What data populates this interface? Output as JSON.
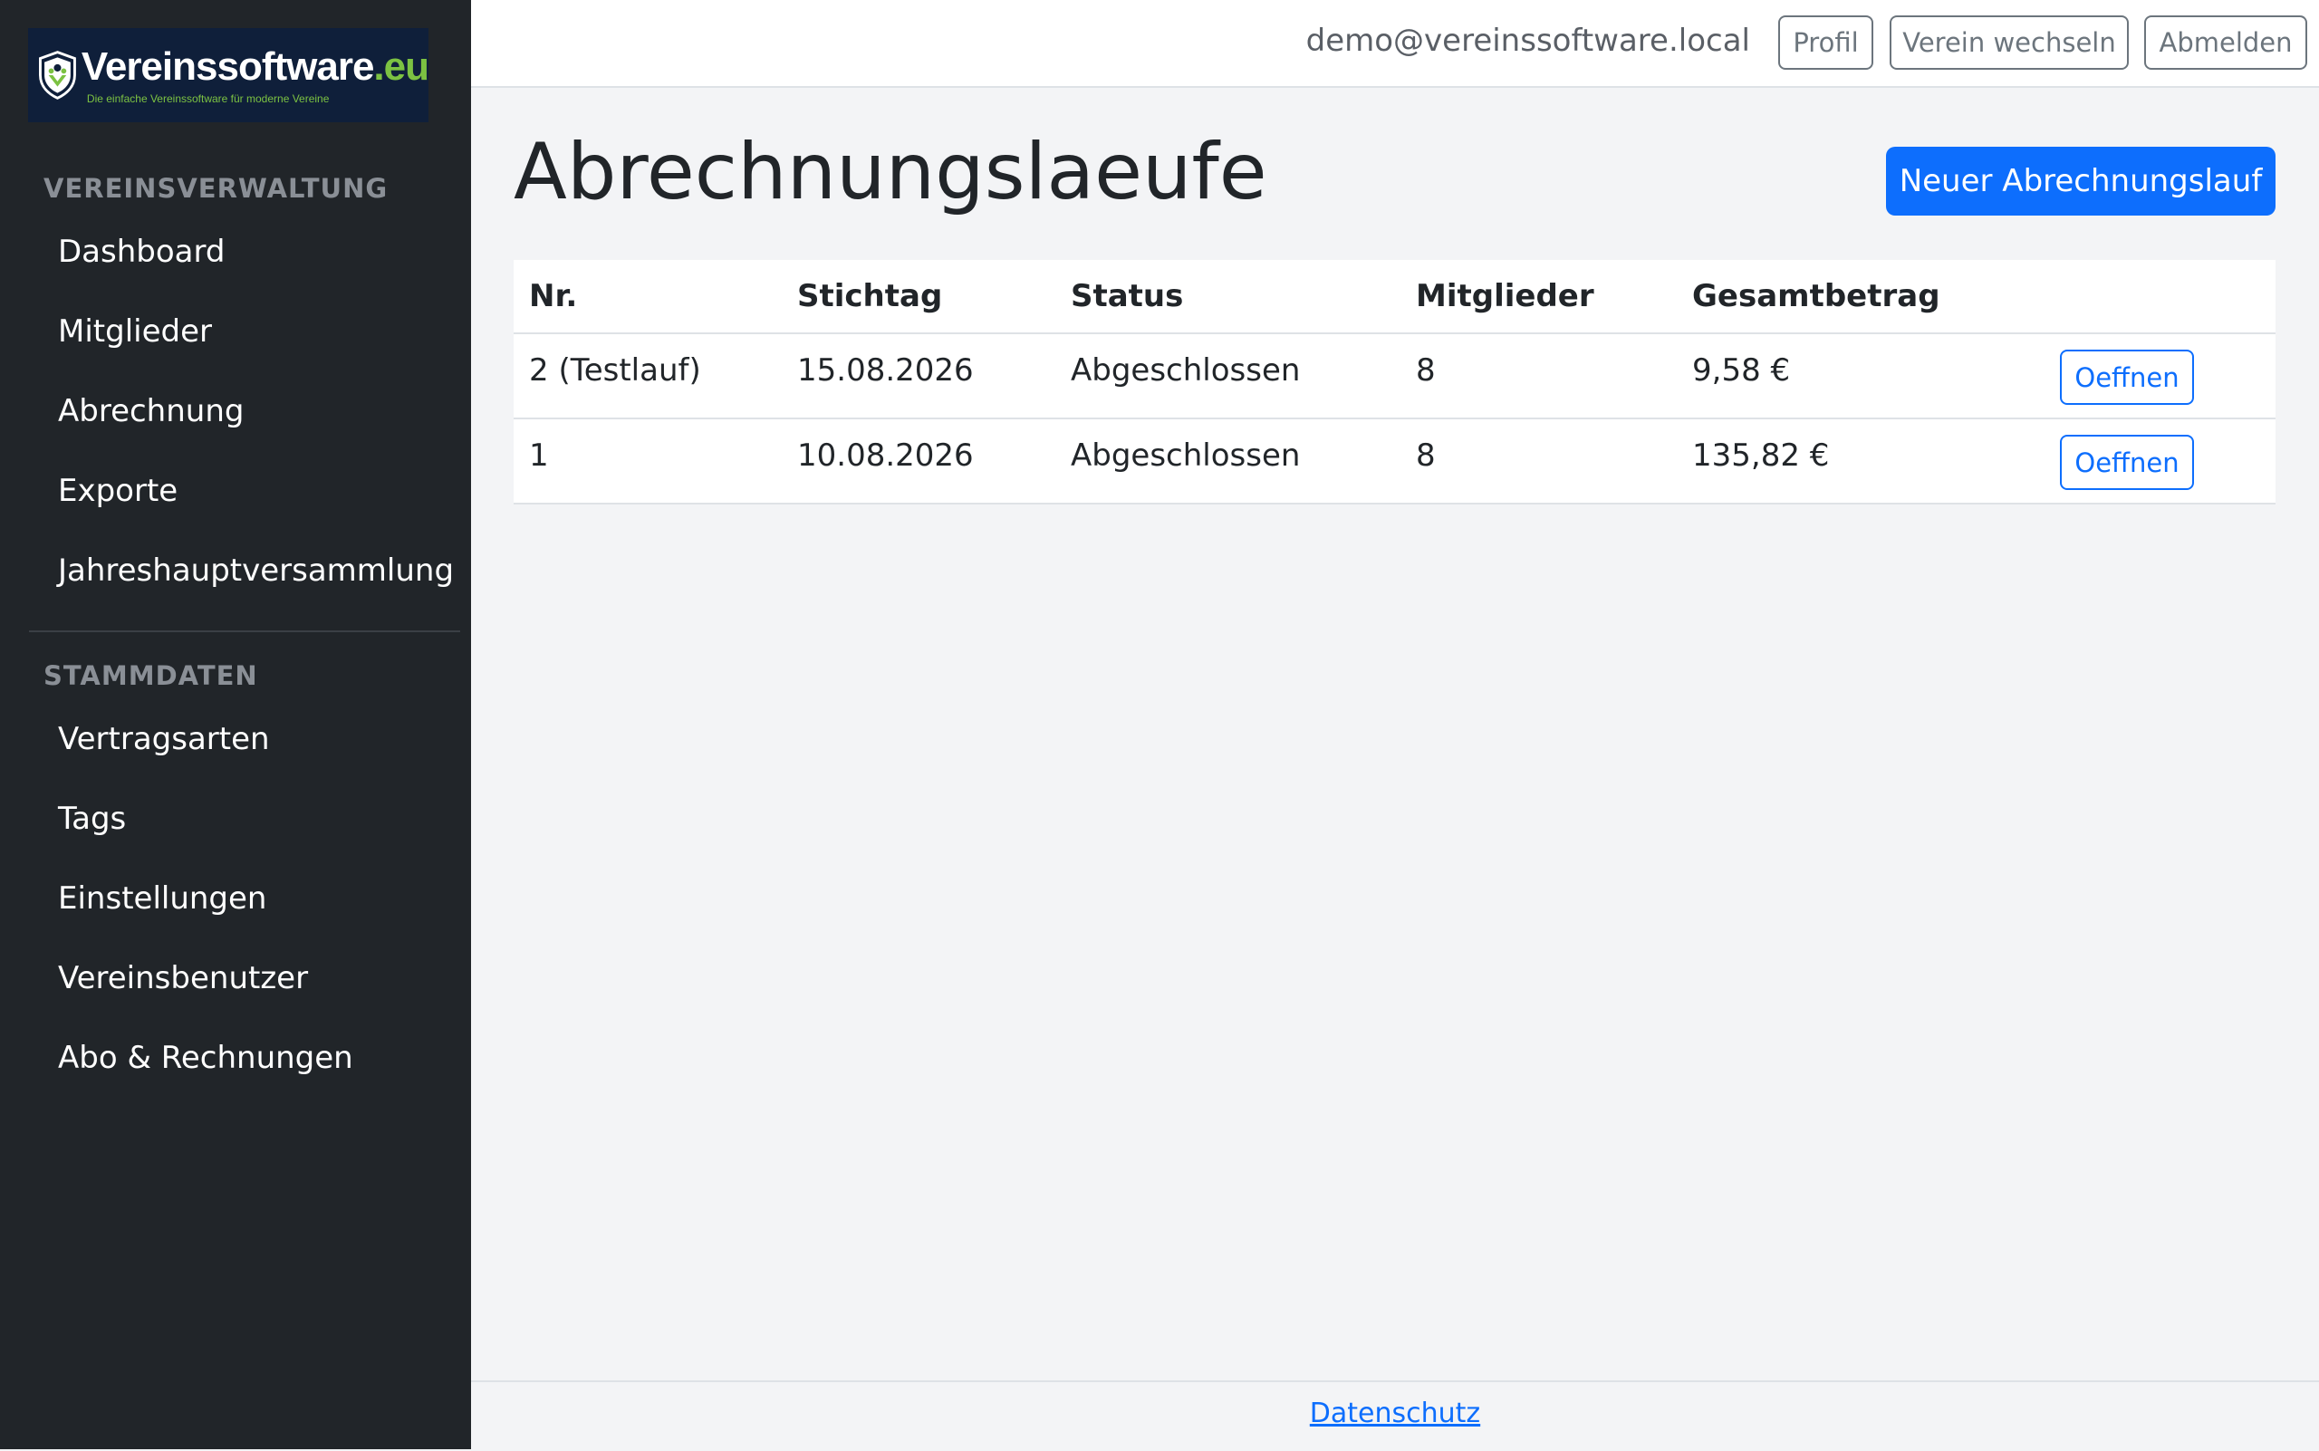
{
  "brand": {
    "name": "Vereinssoftware",
    "tld": ".eu",
    "tagline": "Die einfache Vereinssoftware für moderne Vereine",
    "colors": {
      "navy": "#0f1f3a",
      "green": "#7cc242"
    }
  },
  "sidebar": {
    "section1": "VEREINSVERWALTUNG",
    "items1": [
      "Dashboard",
      "Mitglieder",
      "Abrechnung",
      "Exporte",
      "Jahreshauptversammlung"
    ],
    "section2": "STAMMDATEN",
    "items2": [
      "Vertragsarten",
      "Tags",
      "Einstellungen",
      "Vereinsbenutzer",
      "Abo & Rechnungen"
    ]
  },
  "topbar": {
    "user_email": "demo@vereinssoftware.local",
    "profile": "Profil",
    "switch_club": "Verein wechseln",
    "logout": "Abmelden"
  },
  "page": {
    "title": "Abrechnungslaeufe",
    "new_button": "Neuer Abrechnungslauf"
  },
  "table": {
    "headers": [
      "Nr.",
      "Stichtag",
      "Status",
      "Mitglieder",
      "Gesamtbetrag"
    ],
    "rows": [
      {
        "nr": "2 (Testlauf)",
        "stichtag": "15.08.2026",
        "status": "Abgeschlossen",
        "mitglieder": "8",
        "betrag": "9,58 €",
        "action": "Oeffnen"
      },
      {
        "nr": "1",
        "stichtag": "10.08.2026",
        "status": "Abgeschlossen",
        "mitglieder": "8",
        "betrag": "135,82 €",
        "action": "Oeffnen"
      }
    ]
  },
  "footer": {
    "privacy": "Datenschutz"
  },
  "colors": {
    "primary": "#0d6efd",
    "sidebar_bg": "#212529",
    "page_bg": "#f3f4f6"
  }
}
